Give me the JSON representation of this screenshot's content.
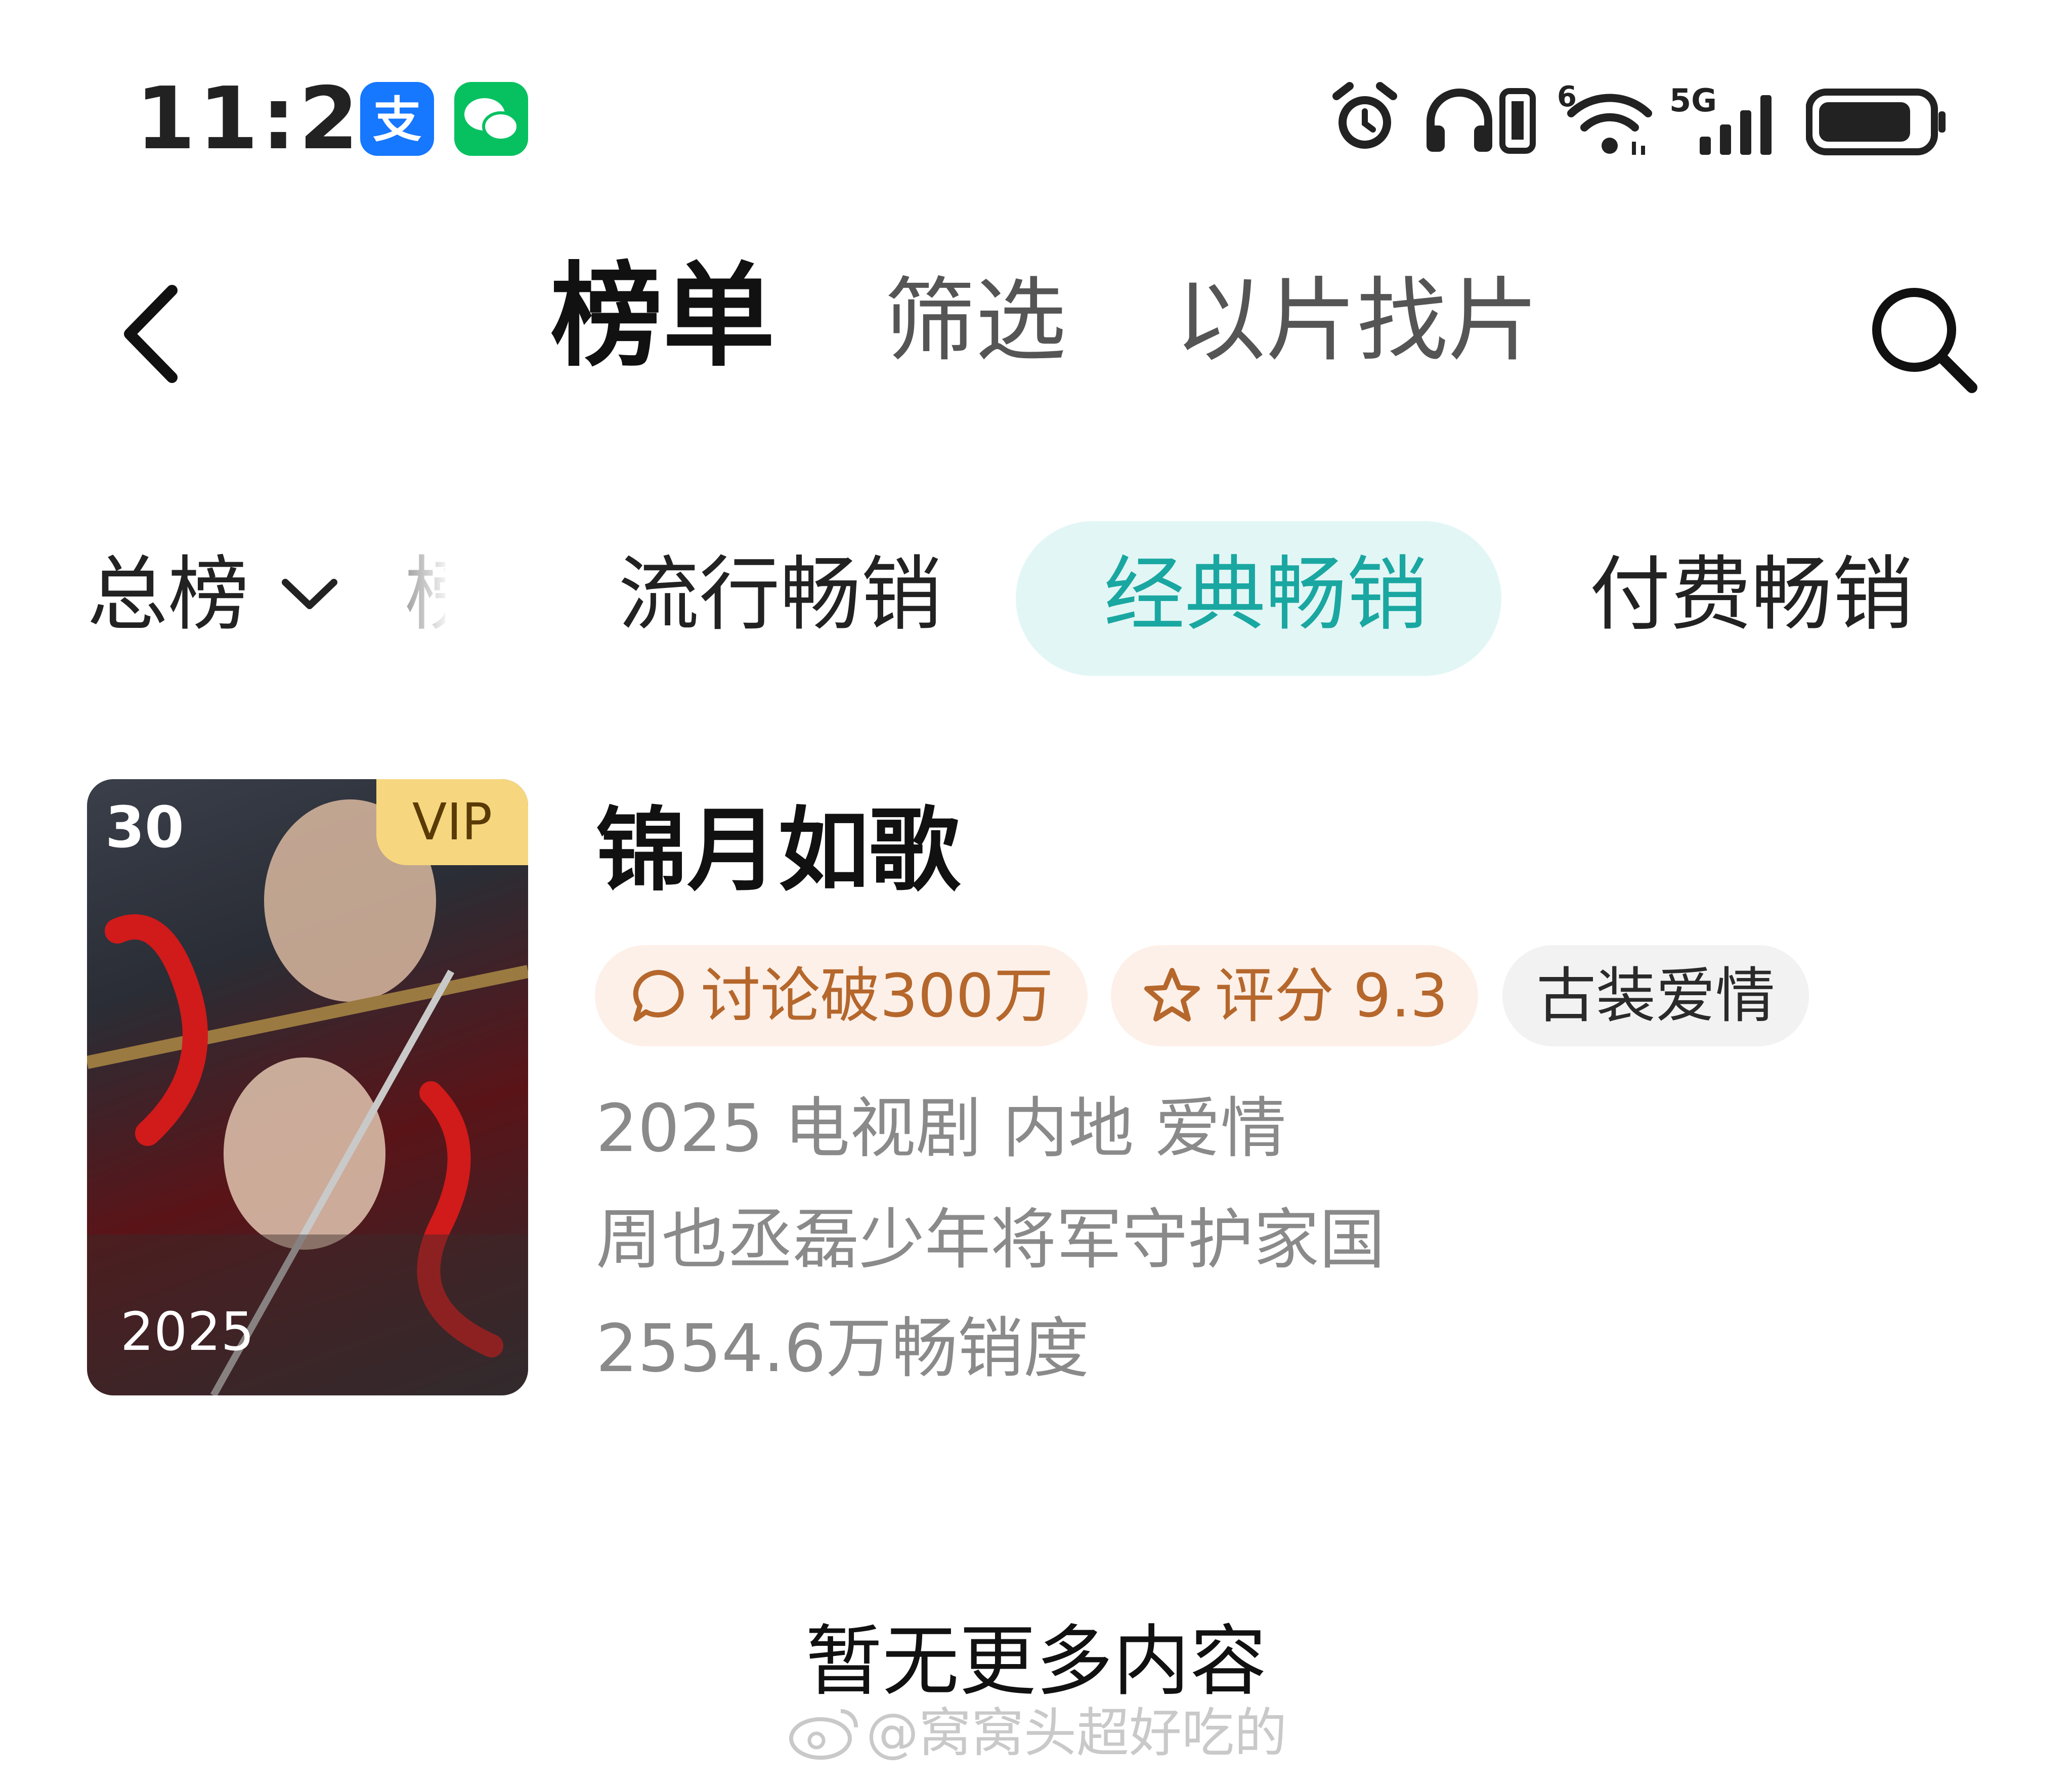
{
  "status_bar": {
    "time": "11:22",
    "apps": [
      "alipay-icon",
      "wechat-icon"
    ],
    "right_icons": [
      "alarm-icon",
      "headphones-icon",
      "vibrate-icon",
      "wifi-icon",
      "signal-5g-icon",
      "battery-icon"
    ],
    "wifi_badge": "6",
    "signal_badge": "5G"
  },
  "nav": {
    "back_icon": "chevron-left-icon",
    "tabs": [
      "榜单",
      "筛选",
      "以片找片"
    ],
    "search_icon": "search-icon"
  },
  "categories": {
    "dropdown_label": "总榜",
    "partial_label": "榜",
    "items": [
      "流行畅销",
      "经典畅销",
      "付费畅销"
    ],
    "active": "经典畅销",
    "accent_color": "#1aa7a1"
  },
  "item": {
    "rank": "30",
    "badge": "VIP",
    "poster_year": "2025",
    "title": "锦月如歌",
    "tags": {
      "discuss": "讨论破300万",
      "score": "评分 9.3",
      "genre": "古装爱情"
    },
    "meta_line": "2025 电视剧 内地 爱情",
    "description": "周也丞磊少年将军守护家国",
    "sales": "2554.6万畅销度"
  },
  "footer": {
    "no_more": "暂无更多内容",
    "watermark": "@窝窝头超好吃的"
  }
}
